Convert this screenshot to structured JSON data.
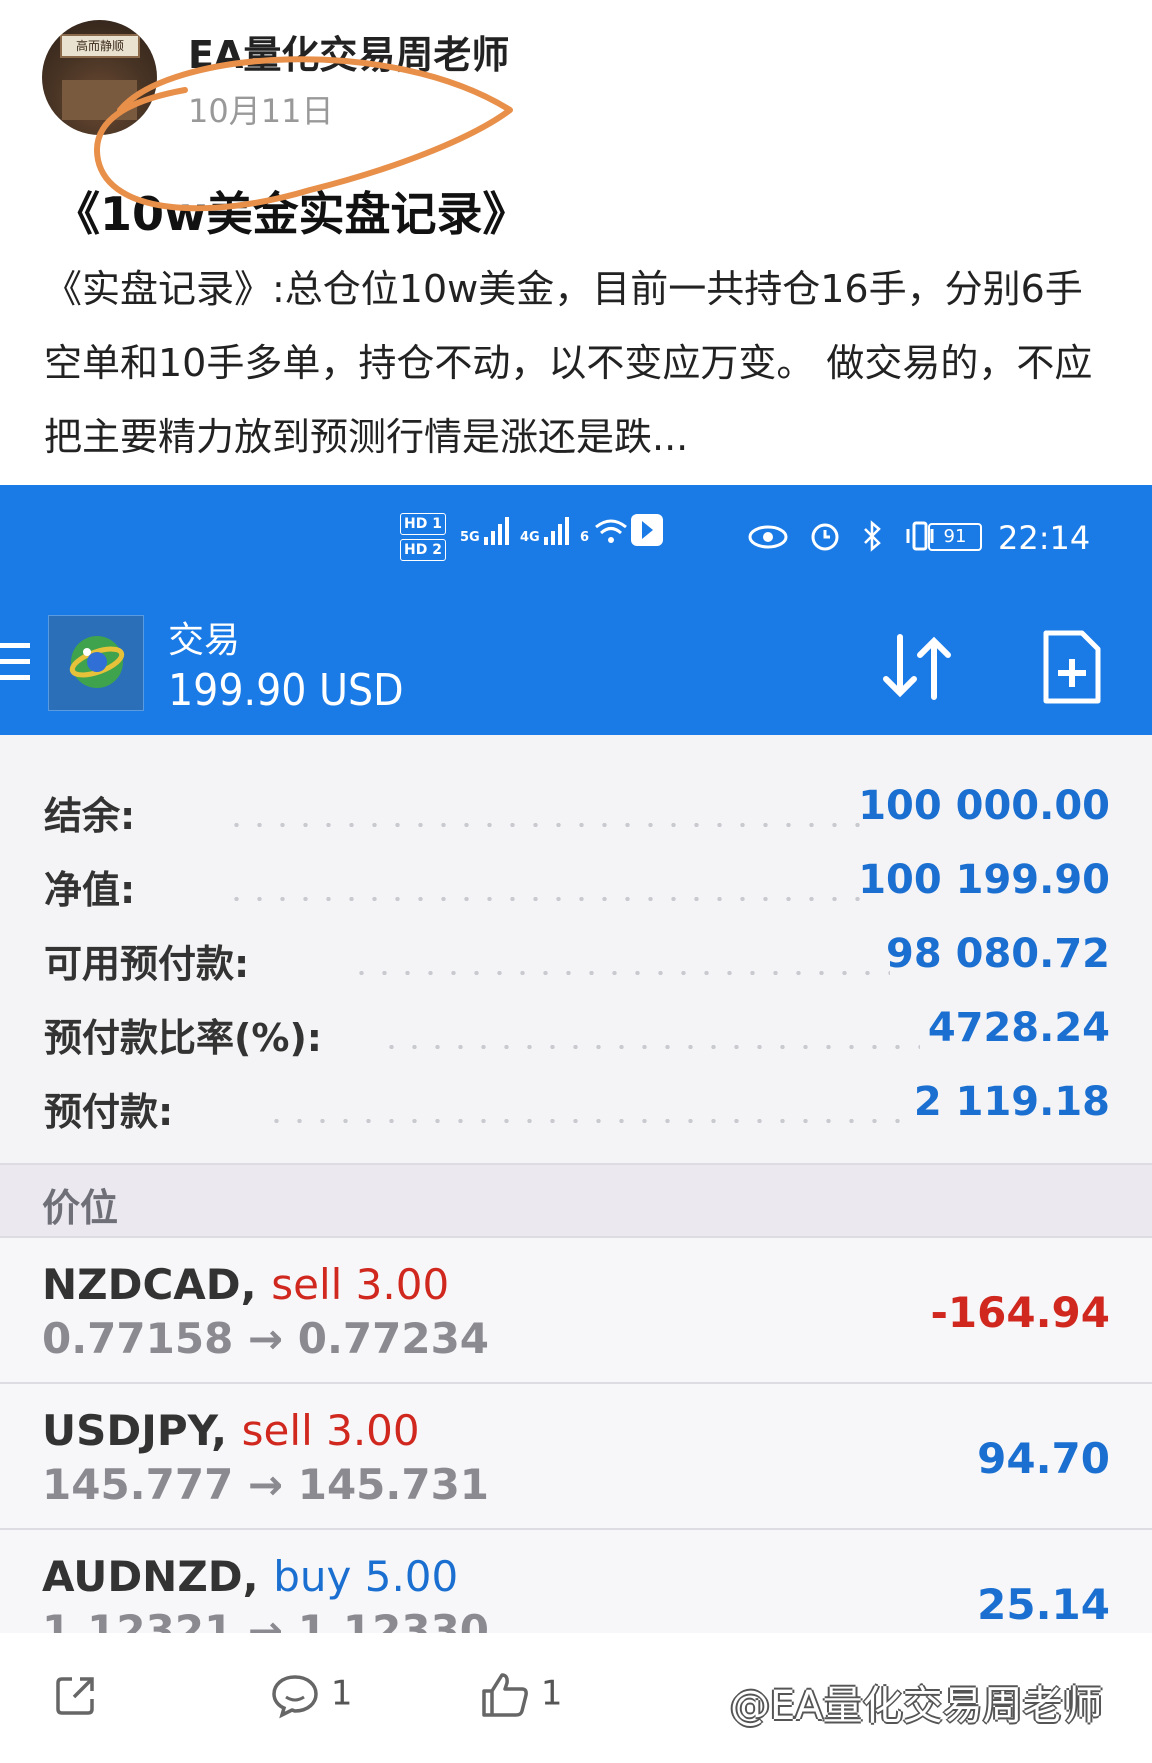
{
  "post": {
    "author": "EA量化交易周老师",
    "date": "10月11日",
    "title": "《10w美金实盘记录》",
    "body": "《实盘记录》:总仓位10w美金，目前一共持仓16手，分别6手空单和10手多单，持仓不动，以不变应万变。 做交易的，不应把主要精力放到预测行情是涨还是跌...",
    "avatar_plaque": "高而静顺"
  },
  "status_bar": {
    "time": "22:14",
    "battery": "91",
    "hd1": "HD 1",
    "hd2": "HD 2",
    "net1": "5G",
    "net2": "4G",
    "net3": "6"
  },
  "app": {
    "title": "交易",
    "balance": "199.90 USD",
    "icons": [
      "menu-icon",
      "mt4-logo",
      "sort-icon",
      "new-order-icon"
    ]
  },
  "summary": [
    {
      "label": "结余:",
      "value": "100 000.00"
    },
    {
      "label": "净值:",
      "value": "100 199.90"
    },
    {
      "label": "可用预付款:",
      "value": "98 080.72"
    },
    {
      "label": "预付款比率(%):",
      "value": "4728.24"
    },
    {
      "label": "预付款:",
      "value": "2 119.18"
    }
  ],
  "section_label": "价位",
  "positions": [
    {
      "symbol": "NZDCAD,",
      "side": "sell",
      "lots": "3.00",
      "prices": "0.77158 → 0.77234",
      "profit": "-164.94"
    },
    {
      "symbol": "USDJPY,",
      "side": "sell",
      "lots": "3.00",
      "prices": "145.777 → 145.731",
      "profit": "94.70"
    },
    {
      "symbol": "AUDNZD,",
      "side": "buy",
      "lots": "5.00",
      "prices": "1.12321 → 1.12330",
      "profit": "25.14"
    }
  ],
  "actions": {
    "comments": "1",
    "likes": "1",
    "watermark": "@EA量化交易周老师"
  },
  "colors": {
    "header_blue": "#1a7be6",
    "value_blue": "#1a6fd0",
    "sell_red": "#d0281f",
    "annotation_orange": "#e8904a"
  }
}
